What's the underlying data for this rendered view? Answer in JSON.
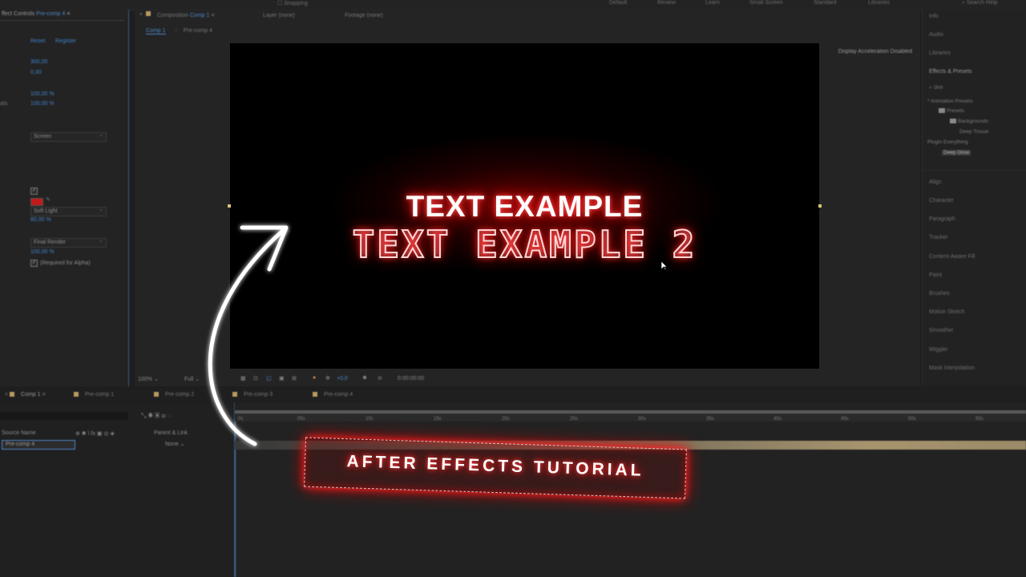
{
  "topbar": {
    "workspaces": [
      "Default",
      "Review",
      "Learn",
      "Small Screen",
      "Standard",
      "Libraries"
    ],
    "search": "Search Help",
    "snapping": "Snapping"
  },
  "effect_controls": {
    "tab_prefix": "ffect Controls",
    "tab_comp": "Pre-comp 4",
    "reset": "Reset",
    "register": "Register",
    "value1": "300,00",
    "value2": "0,30",
    "value3": "100,00 %",
    "value4": "100,00 %",
    "label_ats": "ats",
    "blend_mode": "Screen",
    "blend2": "Soft Light",
    "percent": "80,00 %",
    "render": "Final Render",
    "value5": "100,00 %",
    "alpha_note": "(Required for Alpha)",
    "accent_color": "#c21a1a"
  },
  "composition": {
    "tab_label": "Composition",
    "tab_name": "Comp 1",
    "layer_tab": "Layer (none)",
    "footage_tab": "Footage (none)",
    "subtab1": "Comp 1",
    "subtab2": "Pre-comp 4",
    "accel_notice": "Display Acceleration Disabled",
    "text_line1": "TEXT EXAMPLE",
    "text_line2": "TEXT EXAMPLE 2",
    "zoom": "100%",
    "resolution": "Full",
    "exposure": "+0,0",
    "timecode": "0:00:00:00"
  },
  "right_panel": {
    "panels": [
      "Info",
      "Audio",
      "Libraries",
      "Effects & Presets",
      "Align",
      "Character",
      "Paragraph",
      "Tracker",
      "Content-Aware Fill",
      "Paint",
      "Brushes",
      "Motion Sketch",
      "Smoother",
      "Wiggler",
      "Mask Interpolation"
    ],
    "search_value": "dee",
    "tree": [
      "* Animation Presets",
      "Presets",
      "Backgrounds",
      "Deep Tissue",
      "Plugin Everything",
      "Deep Glow"
    ]
  },
  "timeline": {
    "tabs": [
      "Comp 1",
      "Pre-comp 1",
      "Pre-comp 2",
      "Pre-comp 3",
      "Pre-comp 4"
    ],
    "col_source": "Source Name",
    "col_parent": "Parent & Link",
    "layer_name": "Pre-comp 4",
    "parent_value": "None",
    "ruler": [
      "0s",
      "05s",
      "10s",
      "15s",
      "20s",
      "25s",
      "30s",
      "35s",
      "40s",
      "45s",
      "50s",
      "55s"
    ]
  },
  "overlay": {
    "badge_text": "AFTER EFFECTS TUTORIAL",
    "glow_color": "#ff1a1a"
  }
}
